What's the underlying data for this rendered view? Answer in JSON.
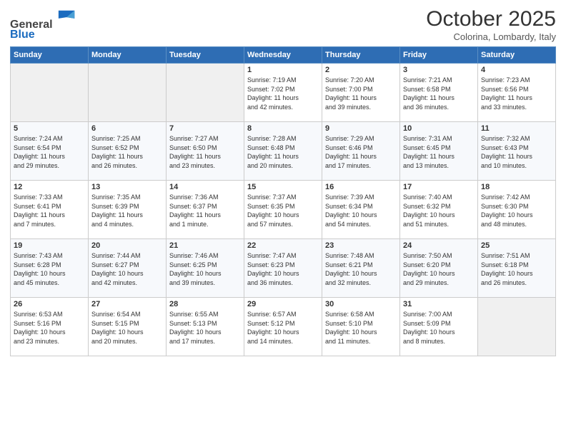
{
  "header": {
    "logo_general": "General",
    "logo_blue": "Blue",
    "month_title": "October 2025",
    "subtitle": "Colorina, Lombardy, Italy"
  },
  "calendar": {
    "headers": [
      "Sunday",
      "Monday",
      "Tuesday",
      "Wednesday",
      "Thursday",
      "Friday",
      "Saturday"
    ],
    "rows": [
      [
        {
          "day": "",
          "info": "",
          "empty": true
        },
        {
          "day": "",
          "info": "",
          "empty": true
        },
        {
          "day": "",
          "info": "",
          "empty": true
        },
        {
          "day": "1",
          "info": "Sunrise: 7:19 AM\nSunset: 7:02 PM\nDaylight: 11 hours\nand 42 minutes.",
          "empty": false
        },
        {
          "day": "2",
          "info": "Sunrise: 7:20 AM\nSunset: 7:00 PM\nDaylight: 11 hours\nand 39 minutes.",
          "empty": false
        },
        {
          "day": "3",
          "info": "Sunrise: 7:21 AM\nSunset: 6:58 PM\nDaylight: 11 hours\nand 36 minutes.",
          "empty": false
        },
        {
          "day": "4",
          "info": "Sunrise: 7:23 AM\nSunset: 6:56 PM\nDaylight: 11 hours\nand 33 minutes.",
          "empty": false
        }
      ],
      [
        {
          "day": "5",
          "info": "Sunrise: 7:24 AM\nSunset: 6:54 PM\nDaylight: 11 hours\nand 29 minutes.",
          "empty": false
        },
        {
          "day": "6",
          "info": "Sunrise: 7:25 AM\nSunset: 6:52 PM\nDaylight: 11 hours\nand 26 minutes.",
          "empty": false
        },
        {
          "day": "7",
          "info": "Sunrise: 7:27 AM\nSunset: 6:50 PM\nDaylight: 11 hours\nand 23 minutes.",
          "empty": false
        },
        {
          "day": "8",
          "info": "Sunrise: 7:28 AM\nSunset: 6:48 PM\nDaylight: 11 hours\nand 20 minutes.",
          "empty": false
        },
        {
          "day": "9",
          "info": "Sunrise: 7:29 AM\nSunset: 6:46 PM\nDaylight: 11 hours\nand 17 minutes.",
          "empty": false
        },
        {
          "day": "10",
          "info": "Sunrise: 7:31 AM\nSunset: 6:45 PM\nDaylight: 11 hours\nand 13 minutes.",
          "empty": false
        },
        {
          "day": "11",
          "info": "Sunrise: 7:32 AM\nSunset: 6:43 PM\nDaylight: 11 hours\nand 10 minutes.",
          "empty": false
        }
      ],
      [
        {
          "day": "12",
          "info": "Sunrise: 7:33 AM\nSunset: 6:41 PM\nDaylight: 11 hours\nand 7 minutes.",
          "empty": false
        },
        {
          "day": "13",
          "info": "Sunrise: 7:35 AM\nSunset: 6:39 PM\nDaylight: 11 hours\nand 4 minutes.",
          "empty": false
        },
        {
          "day": "14",
          "info": "Sunrise: 7:36 AM\nSunset: 6:37 PM\nDaylight: 11 hours\nand 1 minute.",
          "empty": false
        },
        {
          "day": "15",
          "info": "Sunrise: 7:37 AM\nSunset: 6:35 PM\nDaylight: 10 hours\nand 57 minutes.",
          "empty": false
        },
        {
          "day": "16",
          "info": "Sunrise: 7:39 AM\nSunset: 6:34 PM\nDaylight: 10 hours\nand 54 minutes.",
          "empty": false
        },
        {
          "day": "17",
          "info": "Sunrise: 7:40 AM\nSunset: 6:32 PM\nDaylight: 10 hours\nand 51 minutes.",
          "empty": false
        },
        {
          "day": "18",
          "info": "Sunrise: 7:42 AM\nSunset: 6:30 PM\nDaylight: 10 hours\nand 48 minutes.",
          "empty": false
        }
      ],
      [
        {
          "day": "19",
          "info": "Sunrise: 7:43 AM\nSunset: 6:28 PM\nDaylight: 10 hours\nand 45 minutes.",
          "empty": false
        },
        {
          "day": "20",
          "info": "Sunrise: 7:44 AM\nSunset: 6:27 PM\nDaylight: 10 hours\nand 42 minutes.",
          "empty": false
        },
        {
          "day": "21",
          "info": "Sunrise: 7:46 AM\nSunset: 6:25 PM\nDaylight: 10 hours\nand 39 minutes.",
          "empty": false
        },
        {
          "day": "22",
          "info": "Sunrise: 7:47 AM\nSunset: 6:23 PM\nDaylight: 10 hours\nand 36 minutes.",
          "empty": false
        },
        {
          "day": "23",
          "info": "Sunrise: 7:48 AM\nSunset: 6:21 PM\nDaylight: 10 hours\nand 32 minutes.",
          "empty": false
        },
        {
          "day": "24",
          "info": "Sunrise: 7:50 AM\nSunset: 6:20 PM\nDaylight: 10 hours\nand 29 minutes.",
          "empty": false
        },
        {
          "day": "25",
          "info": "Sunrise: 7:51 AM\nSunset: 6:18 PM\nDaylight: 10 hours\nand 26 minutes.",
          "empty": false
        }
      ],
      [
        {
          "day": "26",
          "info": "Sunrise: 6:53 AM\nSunset: 5:16 PM\nDaylight: 10 hours\nand 23 minutes.",
          "empty": false
        },
        {
          "day": "27",
          "info": "Sunrise: 6:54 AM\nSunset: 5:15 PM\nDaylight: 10 hours\nand 20 minutes.",
          "empty": false
        },
        {
          "day": "28",
          "info": "Sunrise: 6:55 AM\nSunset: 5:13 PM\nDaylight: 10 hours\nand 17 minutes.",
          "empty": false
        },
        {
          "day": "29",
          "info": "Sunrise: 6:57 AM\nSunset: 5:12 PM\nDaylight: 10 hours\nand 14 minutes.",
          "empty": false
        },
        {
          "day": "30",
          "info": "Sunrise: 6:58 AM\nSunset: 5:10 PM\nDaylight: 10 hours\nand 11 minutes.",
          "empty": false
        },
        {
          "day": "31",
          "info": "Sunrise: 7:00 AM\nSunset: 5:09 PM\nDaylight: 10 hours\nand 8 minutes.",
          "empty": false
        },
        {
          "day": "",
          "info": "",
          "empty": true
        }
      ]
    ]
  }
}
